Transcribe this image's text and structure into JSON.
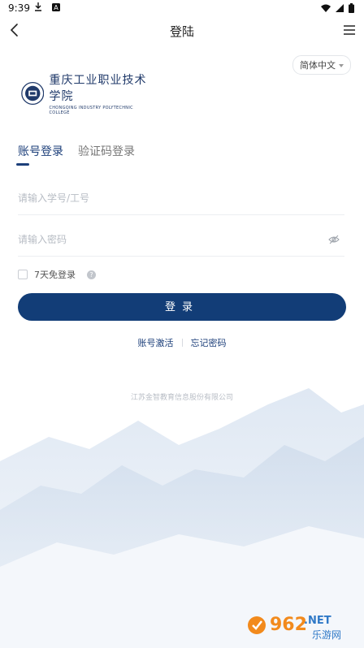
{
  "status_bar": {
    "time": "9:39",
    "icons_left": [
      "download-icon",
      "a-icon"
    ],
    "icons_right": [
      "wifi-icon",
      "signal-icon",
      "battery-icon"
    ]
  },
  "nav": {
    "title": "登陆",
    "back_icon": "chevron-left-icon",
    "menu_icon": "menu-icon"
  },
  "language": {
    "selected": "简体中文"
  },
  "logo": {
    "name_cn": "重庆工业职业技术学院",
    "name_en": "CHONGQING INDUSTRY POLYTECHNIC COLLEGE"
  },
  "tabs": [
    {
      "label": "账号登录",
      "active": true
    },
    {
      "label": "验证码登录",
      "active": false
    }
  ],
  "form": {
    "account_placeholder": "请输入学号/工号",
    "password_placeholder": "请输入密码",
    "remember_label": "7天免登录",
    "help_glyph": "?",
    "login_button": "登录"
  },
  "links": {
    "activate": "账号激活",
    "forgot": "忘记密码"
  },
  "footer": {
    "company": "江苏金智教育信息股份有限公司"
  },
  "watermark": {
    "brand": "962",
    "suffix": ".NET",
    "site": "乐游网"
  },
  "colors": {
    "primary": "#123d77",
    "accent_text": "#1c3f7a",
    "placeholder": "#b7bcc4",
    "watermark_orange": "#f28a1c",
    "watermark_blue": "#2f79c7"
  }
}
